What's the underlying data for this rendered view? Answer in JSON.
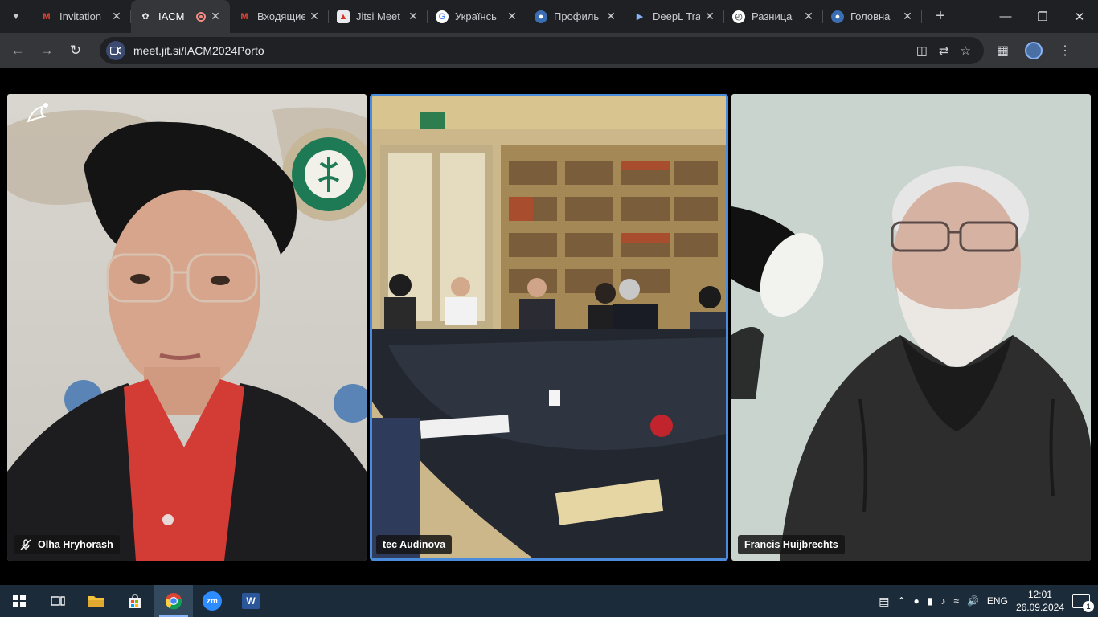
{
  "browser": {
    "tabs": [
      {
        "title": "Invitation",
        "icon": "gmail-icon",
        "active": false
      },
      {
        "title": "IACM",
        "icon": "jitsi-icon",
        "active": true,
        "recording": true
      },
      {
        "title": "Входящие",
        "icon": "gmail-icon",
        "active": false
      },
      {
        "title": "Jitsi Meet",
        "icon": "jitsi-meet-icon",
        "active": false
      },
      {
        "title": "Українсь",
        "icon": "google-icon",
        "active": false
      },
      {
        "title": "Профиль",
        "icon": "profile-icon",
        "active": false
      },
      {
        "title": "DeepL Tra",
        "icon": "deepl-icon",
        "active": false
      },
      {
        "title": "Разница",
        "icon": "clock-icon",
        "active": false
      },
      {
        "title": "Головна",
        "icon": "site-icon",
        "active": false
      }
    ],
    "url": "meet.jit.si/IACM2024Porto"
  },
  "meeting": {
    "participants": [
      {
        "name": "Olha Hryhorash",
        "muted": true
      },
      {
        "name": "tec Audinova",
        "muted": false,
        "dominant_speaker": true
      },
      {
        "name": "Francis Huijbrechts",
        "muted": false
      }
    ]
  },
  "taskbar": {
    "apps": [
      "start-icon",
      "task-view-icon",
      "file-explorer-icon",
      "store-icon",
      "chrome-icon",
      "zoom-icon",
      "word-icon"
    ],
    "zoom_label": "zm",
    "word_label": "W",
    "language": "ENG",
    "time": "12:01",
    "date": "26.09.2024",
    "notifications": "1"
  },
  "colors": {
    "active_speaker_border": "#4a8cdb",
    "taskbar": "#1c2b3a",
    "tabstrip": "#1f2023"
  }
}
